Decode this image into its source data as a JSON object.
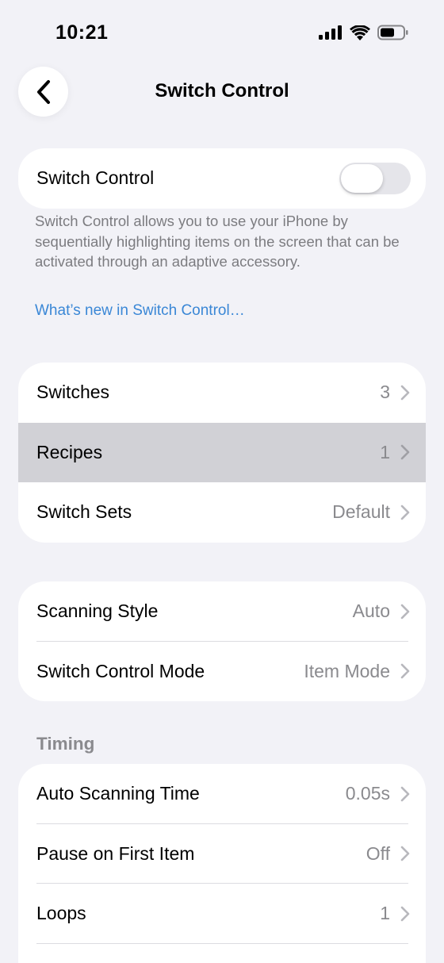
{
  "status_bar": {
    "time": "10:21"
  },
  "nav": {
    "title": "Switch Control",
    "back_icon": "chevron-left-icon"
  },
  "main_toggle": {
    "label": "Switch Control",
    "on": false
  },
  "description": "Switch Control allows you to use your iPhone by sequentially highlighting items on the screen that can be activated through an adaptive accessory.",
  "whats_new_link": "What’s new in Switch Control…",
  "group1": {
    "rows": [
      {
        "label": "Switches",
        "value": "3"
      },
      {
        "label": "Recipes",
        "value": "1"
      },
      {
        "label": "Switch Sets",
        "value": "Default"
      }
    ]
  },
  "group2": {
    "rows": [
      {
        "label": "Scanning Style",
        "value": "Auto"
      },
      {
        "label": "Switch Control Mode",
        "value": "Item Mode"
      }
    ]
  },
  "timing": {
    "header": "Timing",
    "rows": [
      {
        "label": "Auto Scanning Time",
        "value": "0.05s"
      },
      {
        "label": "Pause on First Item",
        "value": "Off"
      },
      {
        "label": "Loops",
        "value": "1"
      }
    ]
  },
  "colors": {
    "background": "#f2f2f7",
    "link": "#3a87d6",
    "highlight": "#d1d1d6"
  }
}
